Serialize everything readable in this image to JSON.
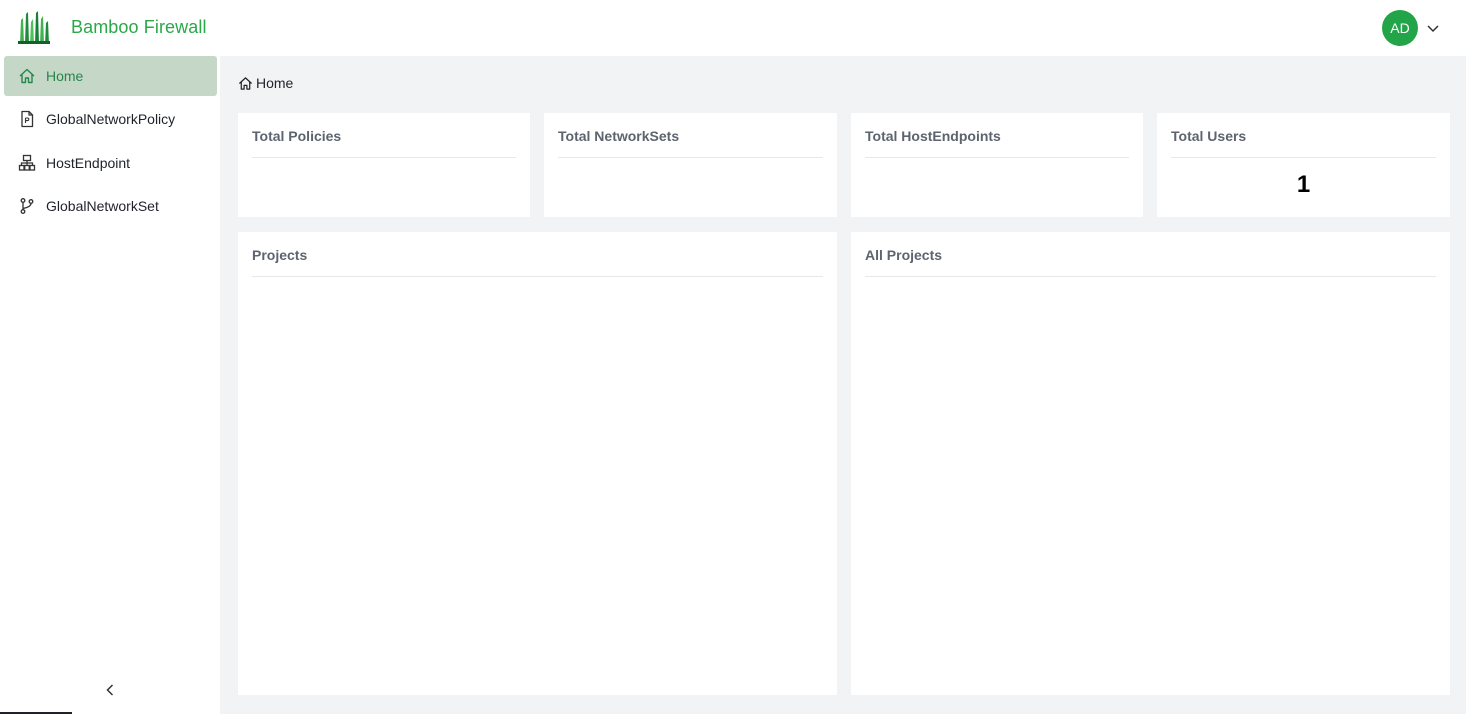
{
  "app": {
    "name": "Bamboo Firewall",
    "brand_color": "#2aa84a"
  },
  "user": {
    "initials": "AD",
    "avatar_color": "#22a449",
    "menu_icon": "chevron-down-icon"
  },
  "sidebar": {
    "items": [
      {
        "label": "Home",
        "icon": "home-icon",
        "active": true
      },
      {
        "label": "GlobalNetworkPolicy",
        "icon": "policy-document-icon",
        "active": false
      },
      {
        "label": "HostEndpoint",
        "icon": "sitemap-icon",
        "active": false
      },
      {
        "label": "GlobalNetworkSet",
        "icon": "branch-icon",
        "active": false
      }
    ],
    "collapse_icon": "chevron-left-icon"
  },
  "breadcrumb": {
    "label": "Home",
    "icon": "home-icon"
  },
  "stats": [
    {
      "title": "Total Policies",
      "value": ""
    },
    {
      "title": "Total NetworkSets",
      "value": ""
    },
    {
      "title": "Total HostEndpoints",
      "value": ""
    },
    {
      "title": "Total Users",
      "value": "1"
    }
  ],
  "panels": [
    {
      "title": "Projects"
    },
    {
      "title": "All Projects"
    }
  ]
}
